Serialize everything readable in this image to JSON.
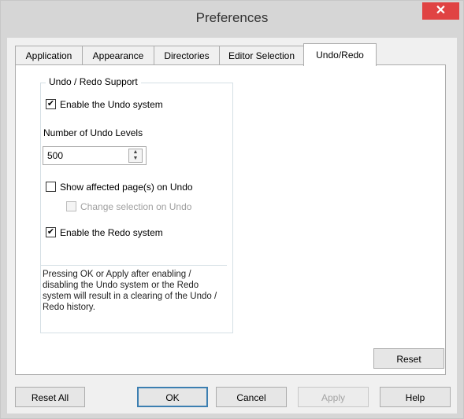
{
  "window": {
    "title": "Preferences",
    "close_glyph": "✕"
  },
  "tabs": [
    {
      "label": "Application",
      "active": false
    },
    {
      "label": "Appearance",
      "active": false
    },
    {
      "label": "Directories",
      "active": false
    },
    {
      "label": "Editor Selection",
      "active": false
    },
    {
      "label": "Undo/Redo",
      "active": true
    }
  ],
  "group": {
    "title": "Undo / Redo Support",
    "enable_undo": {
      "label": "Enable the Undo system",
      "checked": true
    },
    "levels_label": "Number of Undo Levels",
    "levels_value": "500",
    "show_affected": {
      "label": "Show affected page(s) on Undo",
      "checked": false
    },
    "change_selection": {
      "label": "Change selection on Undo",
      "checked": false,
      "disabled": true
    },
    "enable_redo": {
      "label": "Enable the Redo system",
      "checked": true
    },
    "note": "Pressing OK or Apply after enabling / disabling the Undo system or the Redo system will result in a clearing of the Undo / Redo history."
  },
  "buttons": {
    "reset": "Reset",
    "reset_all": "Reset All",
    "ok": "OK",
    "cancel": "Cancel",
    "apply": "Apply",
    "help": "Help"
  },
  "icons": {
    "check": "✔",
    "spin_up": "▲",
    "spin_down": "▼"
  },
  "colors": {
    "close_button": "#e04343",
    "default_button_border": "#3c7fb1",
    "titlebar": "#d6d6d6"
  }
}
